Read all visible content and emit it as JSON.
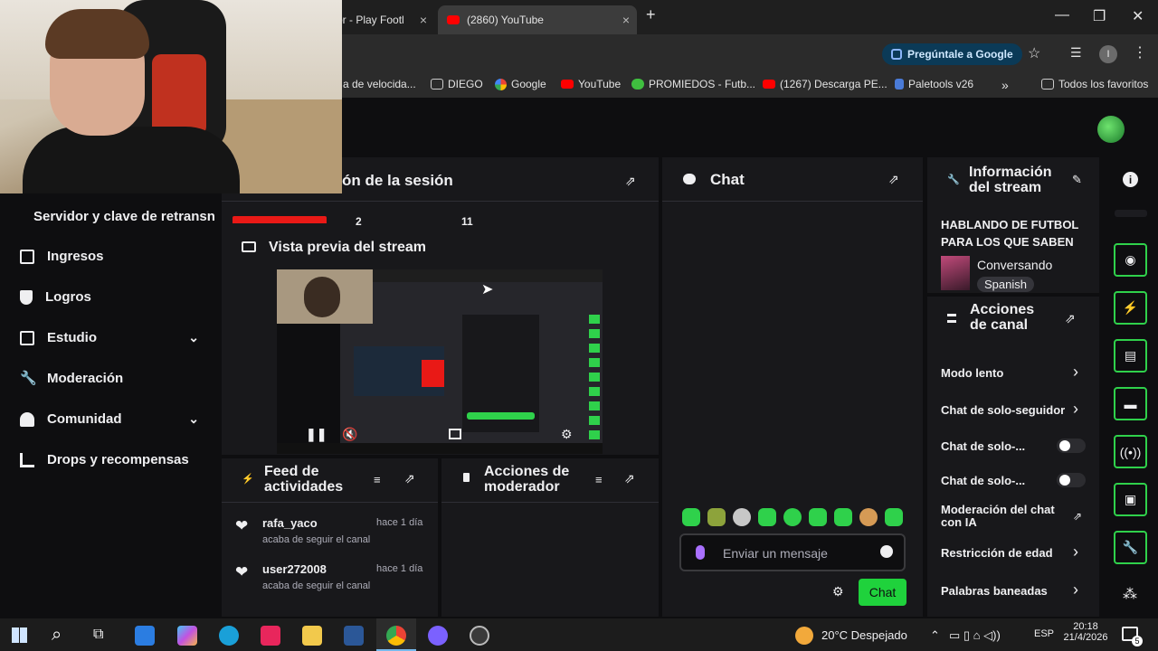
{
  "browser": {
    "tabs": [
      {
        "title": "or - Play Footl",
        "close": "×"
      },
      {
        "title": "(2860) YouTube",
        "close": "×"
      }
    ],
    "new_tab": "+",
    "window": {
      "minimize": "—",
      "maximize": "❐",
      "close": "✕"
    },
    "ask_google": "Pregúntale a Google",
    "profile_initial": "I",
    "bookmarks": [
      {
        "label": "a de velocida..."
      },
      {
        "label": "DIEGO"
      },
      {
        "label": "Google"
      },
      {
        "label": "YouTube"
      },
      {
        "label": "PROMIEDOS - Futb..."
      },
      {
        "label": "(1267) Descarga PE..."
      },
      {
        "label": "Paletools v26"
      }
    ],
    "bookmarks_more": "»",
    "all_favorites": "Todos los favoritos"
  },
  "sidebar": {
    "partial_item": "Servidor y clave de retransn",
    "items": [
      {
        "label": "Ingresos"
      },
      {
        "label": "Logros"
      },
      {
        "label": "Estudio",
        "chevron": "⌄"
      },
      {
        "label": "Moderación"
      },
      {
        "label": "Comunidad",
        "chevron": "⌄"
      },
      {
        "label": "Drops y recompensas"
      }
    ]
  },
  "session": {
    "title": "ón de la sesión",
    "stats": [
      "2",
      "11"
    ]
  },
  "preview": {
    "title": "Vista previa del stream"
  },
  "feed": {
    "title_line1": "Feed de",
    "title_line2": "actividades",
    "items": [
      {
        "user": "rafa_yaco",
        "time": "hace 1 día",
        "action": "acaba de seguir el canal"
      },
      {
        "user": "user272008",
        "time": "hace 1 día",
        "action": "acaba de seguir el canal"
      }
    ]
  },
  "mod_actions": {
    "title_line1": "Acciones de",
    "title_line2": "moderador"
  },
  "chat": {
    "title": "Chat",
    "input_placeholder": "Enviar un mensaje",
    "send_label": "Chat",
    "emote_count": 9
  },
  "stream_info": {
    "title_line1": "Información",
    "title_line2": "del stream",
    "stream_title": "HABLANDO DE FUTBOL PARA LOS QUE SABEN",
    "category": "Conversando",
    "language": "Spanish"
  },
  "channel_actions": {
    "title_line1": "Acciones",
    "title_line2": "de canal",
    "items": [
      {
        "label": "Modo lento",
        "control": "chevron"
      },
      {
        "label": "Chat de solo-seguidor",
        "control": "chevron"
      },
      {
        "label": "Chat de solo-...",
        "control": "toggle"
      },
      {
        "label": "Chat de solo-...",
        "control": "toggle"
      },
      {
        "label": "Moderación del chat con IA",
        "control": "external"
      },
      {
        "label": "Restricción de edad",
        "control": "chevron"
      },
      {
        "label": "Palabras baneadas",
        "control": "chevron"
      }
    ]
  },
  "taskbar": {
    "weather": "20°C  Despejado",
    "lang": "ESP",
    "time": "20:18",
    "date": "21/4/2026",
    "notifications": "5"
  },
  "colors": {
    "accent_green": "#2fd14b",
    "bg": "#0e0e10",
    "panel": "#18181b"
  }
}
